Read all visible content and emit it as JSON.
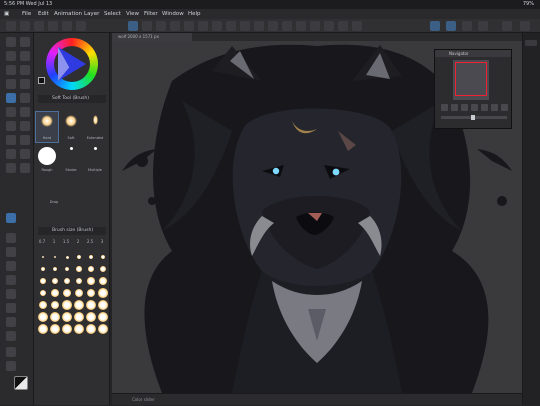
{
  "status": {
    "time": "5:56 PM",
    "date": "Wed Jul 13",
    "battery": "79%"
  },
  "menu": [
    "File",
    "Edit",
    "Animation",
    "Layer",
    "Select",
    "View",
    "Filter",
    "Window",
    "Help"
  ],
  "doc_tab": "wolf 2000 x 1571 px",
  "panels": {
    "brush_group": "Soft Tool (Brush)",
    "brushes": [
      "Hard",
      "Soft",
      "Extended",
      "Rough",
      "Stroke",
      "Multiple",
      "Drop"
    ],
    "brush_size_header": "Brush size (Brush)",
    "brush_sizes": [
      "0.7",
      "1",
      "1.5",
      "2",
      "2.5",
      "3"
    ],
    "navigator": "Navigator"
  },
  "bottom_status": "Color slider",
  "colors": {
    "accent": "#3c6ea8",
    "main_color": "#111111",
    "nav_frame": "#e23333"
  }
}
